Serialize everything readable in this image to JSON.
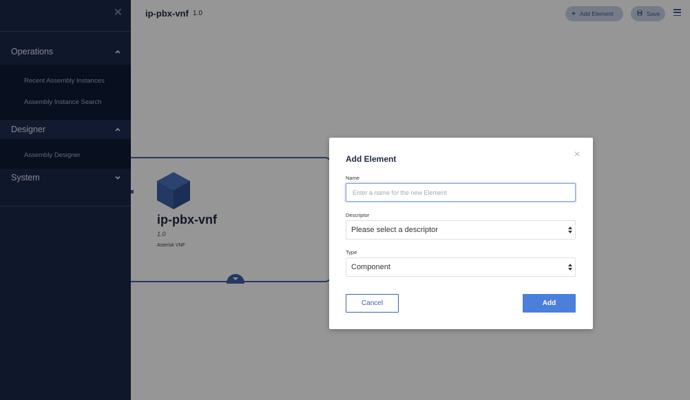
{
  "sidebar": {
    "close_icon": "close-icon",
    "operations": {
      "label": "Operations",
      "expanded": true,
      "items": [
        "Recent Assembly Instances",
        "Assembly Instance Search"
      ]
    },
    "designer": {
      "label": "Designer",
      "expanded": true,
      "items": [
        "Assembly Designer"
      ]
    },
    "system": {
      "label": "System",
      "expanded": false
    }
  },
  "header": {
    "title": "ip-pbx-vnf",
    "version": "1.0",
    "add_element_label": "Add Element",
    "save_label": "Save"
  },
  "canvas": {
    "card": {
      "title": "ip-pbx-vnf",
      "version": "1.0",
      "description": "Asterisk VNF",
      "icon": "cube-icon"
    }
  },
  "modal": {
    "title": "Add Element",
    "name_label": "Name",
    "name_placeholder": "Enter a name for the new Element",
    "name_value": "",
    "descriptor_label": "Descriptor",
    "descriptor_value": "Please select a descriptor",
    "type_label": "Type",
    "type_value": "Component",
    "cancel_label": "Cancel",
    "add_label": "Add"
  },
  "colors": {
    "sidebar_bg": "#1a2848",
    "sidebar_sub_bg": "#0f1a34",
    "accent": "#3d61a9",
    "primary_button": "#4a7fdb",
    "overlay": "rgba(0,0,0,0.41)"
  }
}
